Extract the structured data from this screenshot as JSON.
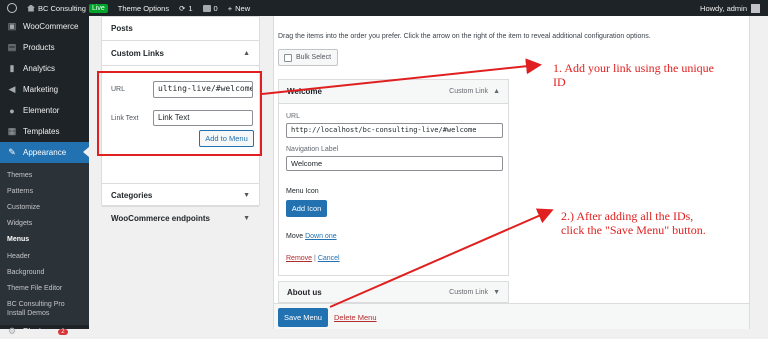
{
  "adminbar": {
    "site_name": "BC Consulting",
    "live_badge": "Live",
    "theme_options": "Theme Options",
    "updates_count": "1",
    "comments_count": "0",
    "new_label": "New",
    "howdy": "Howdy, admin"
  },
  "sidebar": {
    "top_items": [
      {
        "label": "WooCommerce",
        "icon": "woo-icon"
      },
      {
        "label": "Products",
        "icon": "products-icon"
      },
      {
        "label": "Analytics",
        "icon": "analytics-icon"
      },
      {
        "label": "Marketing",
        "icon": "marketing-icon"
      },
      {
        "label": "Elementor",
        "icon": "elementor-icon"
      },
      {
        "label": "Templates",
        "icon": "templates-icon"
      }
    ],
    "active_item": "Appearance",
    "sub_items": [
      "Themes",
      "Patterns",
      "Customize",
      "Widgets",
      "Menus",
      "Header",
      "Background",
      "Theme File Editor"
    ],
    "sub_item_two_line": [
      "BC Consulting Pro",
      "Install Demos"
    ],
    "plugins_label": "Plugins",
    "plugins_badge": "2"
  },
  "panel": {
    "posts": "Posts",
    "custom_links": "Custom Links",
    "url_label": "URL",
    "url_value": "ulting-live/#welcome",
    "link_text_label": "Link Text",
    "link_text_value": "Link Text",
    "add_to_menu": "Add to Menu",
    "categories": "Categories",
    "woo_endpoints": "WooCommerce endpoints"
  },
  "main": {
    "instructions": "Drag the items into the order you prefer. Click the arrow on the right of the item to reveal additional configuration options.",
    "bulk_select": "Bulk Select",
    "welcome_item": {
      "title": "Welcome",
      "type": "Custom Link",
      "url_label": "URL",
      "url_value": "http://localhost/bc-consulting-live/#welcome",
      "nav_label": "Navigation Label",
      "nav_value": "Welcome",
      "menu_icon": "Menu Icon",
      "add_icon": "Add Icon",
      "move_label": "Move",
      "move_link": "Down one",
      "remove": "Remove",
      "separator": "|",
      "cancel": "Cancel"
    },
    "about_item": {
      "title": "About us",
      "type": "Custom Link"
    },
    "save_menu": "Save Menu",
    "delete_menu": "Delete Menu"
  },
  "annotations": {
    "note1_line1": "1. Add your link using the unique",
    "note1_line2": "ID",
    "note2_line1": "2.) After adding all the IDs,",
    "note2_line2": "click the \"Save Menu\" button."
  },
  "colors": {
    "accent": "#2271b1",
    "annotation": "#e02020",
    "sidebar": "#1d2327"
  }
}
